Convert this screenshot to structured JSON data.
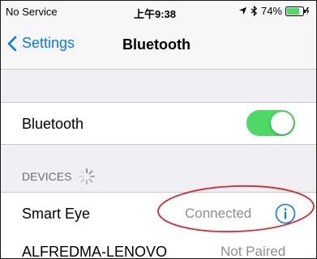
{
  "status_bar": {
    "carrier": "No Service",
    "time": "上午9:38",
    "battery": "74%"
  },
  "nav": {
    "back_label": "Settings",
    "title": "Bluetooth"
  },
  "bluetooth_row": {
    "label": "Bluetooth",
    "toggle_on": true
  },
  "devices_section": {
    "header": "DEVICES"
  },
  "devices": [
    {
      "name": "Smart Eye",
      "status": "Connected"
    },
    {
      "name": "ALFREDMA-LENOVO",
      "status": "Not Paired"
    }
  ],
  "colors": {
    "accent": "#007aff",
    "toggle_on": "#4cd964",
    "annotation": "#e0242a"
  }
}
